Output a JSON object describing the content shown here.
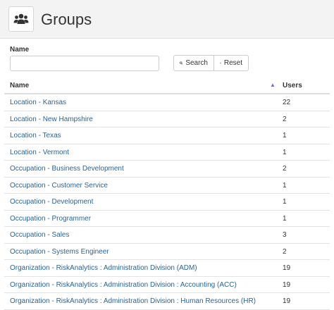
{
  "header": {
    "title": "Groups",
    "icon": "users-icon"
  },
  "filter": {
    "name_label": "Name",
    "name_value": "",
    "name_placeholder": "",
    "search_label": "Search",
    "reset_label": "Reset"
  },
  "table": {
    "columns": [
      "Name",
      "Users"
    ],
    "sort": "ascending",
    "rows": [
      {
        "name": "Location - Kansas",
        "users": "22"
      },
      {
        "name": "Location - New Hampshire",
        "users": "2"
      },
      {
        "name": "Location - Texas",
        "users": "1"
      },
      {
        "name": "Location - Vermont",
        "users": "1"
      },
      {
        "name": "Occupation - Business Development",
        "users": "2"
      },
      {
        "name": "Occupation - Customer Service",
        "users": "1"
      },
      {
        "name": "Occupation - Development",
        "users": "1"
      },
      {
        "name": "Occupation - Programmer",
        "users": "1"
      },
      {
        "name": "Occupation - Sales",
        "users": "3"
      },
      {
        "name": "Occupation - Systems Engineer",
        "users": "2"
      },
      {
        "name": "Organization - RiskAnalytics : Administration Division (ADM)",
        "users": "19"
      },
      {
        "name": "Organization - RiskAnalytics : Administration Division : Accounting (ACC)",
        "users": "19"
      },
      {
        "name": "Organization - RiskAnalytics : Administration Division : Human Resources (HR)",
        "users": "19"
      }
    ]
  },
  "colors": {
    "link": "#2a6496",
    "header_bg": "#f3f3f3",
    "sort_arrow": "#6b6bd6"
  }
}
